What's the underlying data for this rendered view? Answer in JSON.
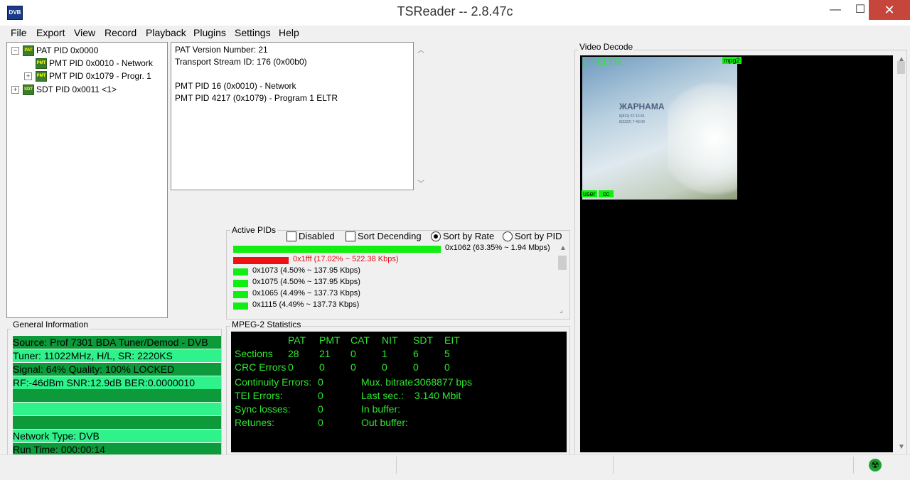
{
  "window": {
    "title": "TSReader -- 2.8.47c",
    "icon_label": "DVB",
    "minimize": "—",
    "maximize": "☐",
    "close": "✕"
  },
  "menu": [
    "File",
    "Export",
    "View",
    "Record",
    "Playback",
    "Plugins",
    "Settings",
    "Help"
  ],
  "tree": {
    "items": [
      {
        "label": "PAT PID 0x0000",
        "expander": "−",
        "icon": "PAT"
      },
      {
        "label": "PMT PID 0x0010 - Network",
        "icon": "PMT"
      },
      {
        "label": "PMT PID 0x1079 - Progr. 1",
        "expander": "+",
        "icon": "PMT"
      },
      {
        "label": "SDT PID 0x0011 <1>",
        "expander": "+",
        "icon": "SDT"
      }
    ]
  },
  "info": {
    "lines": [
      "PAT Version Number: 21",
      "Transport Stream ID: 176 (0x00b0)",
      "",
      "PMT PID 16 (0x0010) - Network",
      "PMT PID 4217 (0x1079) - Program 1 ELTR"
    ]
  },
  "active_pids": {
    "title": "Active PIDs",
    "options": {
      "disabled": "Disabled",
      "sort_descending": "Sort Decending",
      "sort_by_rate": "Sort by Rate",
      "sort_by_pid": "Sort by PID"
    },
    "selected_sort": "Sort by Rate",
    "rows": [
      {
        "label": "0x1062 (63.35% ~ 1.94 Mbps)",
        "percent": 63.35,
        "color": "#11ee11"
      },
      {
        "label": "0x1fff (17.02% ~ 522.38 Kbps)",
        "percent": 17.02,
        "color": "#ee1111"
      },
      {
        "label": "0x1073 (4.50% ~ 137.95 Kbps)",
        "percent": 4.5,
        "color": "#11ee11"
      },
      {
        "label": "0x1075 (4.50% ~ 137.95 Kbps)",
        "percent": 4.5,
        "color": "#11ee11"
      },
      {
        "label": "0x1065 (4.49% ~ 137.73 Kbps)",
        "percent": 4.49,
        "color": "#11ee11"
      },
      {
        "label": "0x1115 (4.49% ~ 137.73 Kbps)",
        "percent": 4.49,
        "color": "#11ee11"
      }
    ]
  },
  "general_info": {
    "title": "General Information",
    "rows": [
      "Source: Prof 7301 BDA Tuner/Demod - DVB",
      "Tuner: 11022MHz, H/L, SR: 2220KS",
      "Signal: 64% Quality: 100% LOCKED",
      "RF:-46dBm SNR:12.9dB BER:0.0000010",
      "",
      "",
      "",
      "Network Type: DVB",
      "Run Time: 000:00:14"
    ]
  },
  "mpeg_stats": {
    "title": "MPEG-2 Statistics",
    "columns": [
      "PAT",
      "PMT",
      "CAT",
      "NIT",
      "SDT",
      "EIT"
    ],
    "sections_label": "Sections",
    "sections": [
      "28",
      "21",
      "0",
      "1",
      "6",
      "5"
    ],
    "crc_label": "CRC Errors",
    "crc": [
      "0",
      "0",
      "0",
      "0",
      "0",
      "0"
    ],
    "continuity_label": "Continuity Errors:",
    "continuity": "0",
    "tei_label": "TEI Errors:",
    "tei": "0",
    "sync_label": "Sync losses:",
    "sync": "0",
    "retunes_label": "Retunes:",
    "retunes": "0",
    "mux_label": "Mux. bitrate:",
    "mux": "3068877 bps",
    "last_label": "Last sec.:",
    "last": "3.140 Mbit",
    "inbuf_label": "In buffer:",
    "outbuf_label": "Out buffer:"
  },
  "video": {
    "title": "Video Decode",
    "channel": "1 - ELTR",
    "codec_badge": "mpg2",
    "user_badge": "user",
    "cc_badge": "cc",
    "frame_heading": "ЖАРНАМА",
    "frame_line1": "8(812) 67-12-61",
    "frame_line2": "8(3222) 7-43-00"
  },
  "colors": {
    "accent_green": "#2fe62f",
    "close_red": "#c7463b"
  }
}
